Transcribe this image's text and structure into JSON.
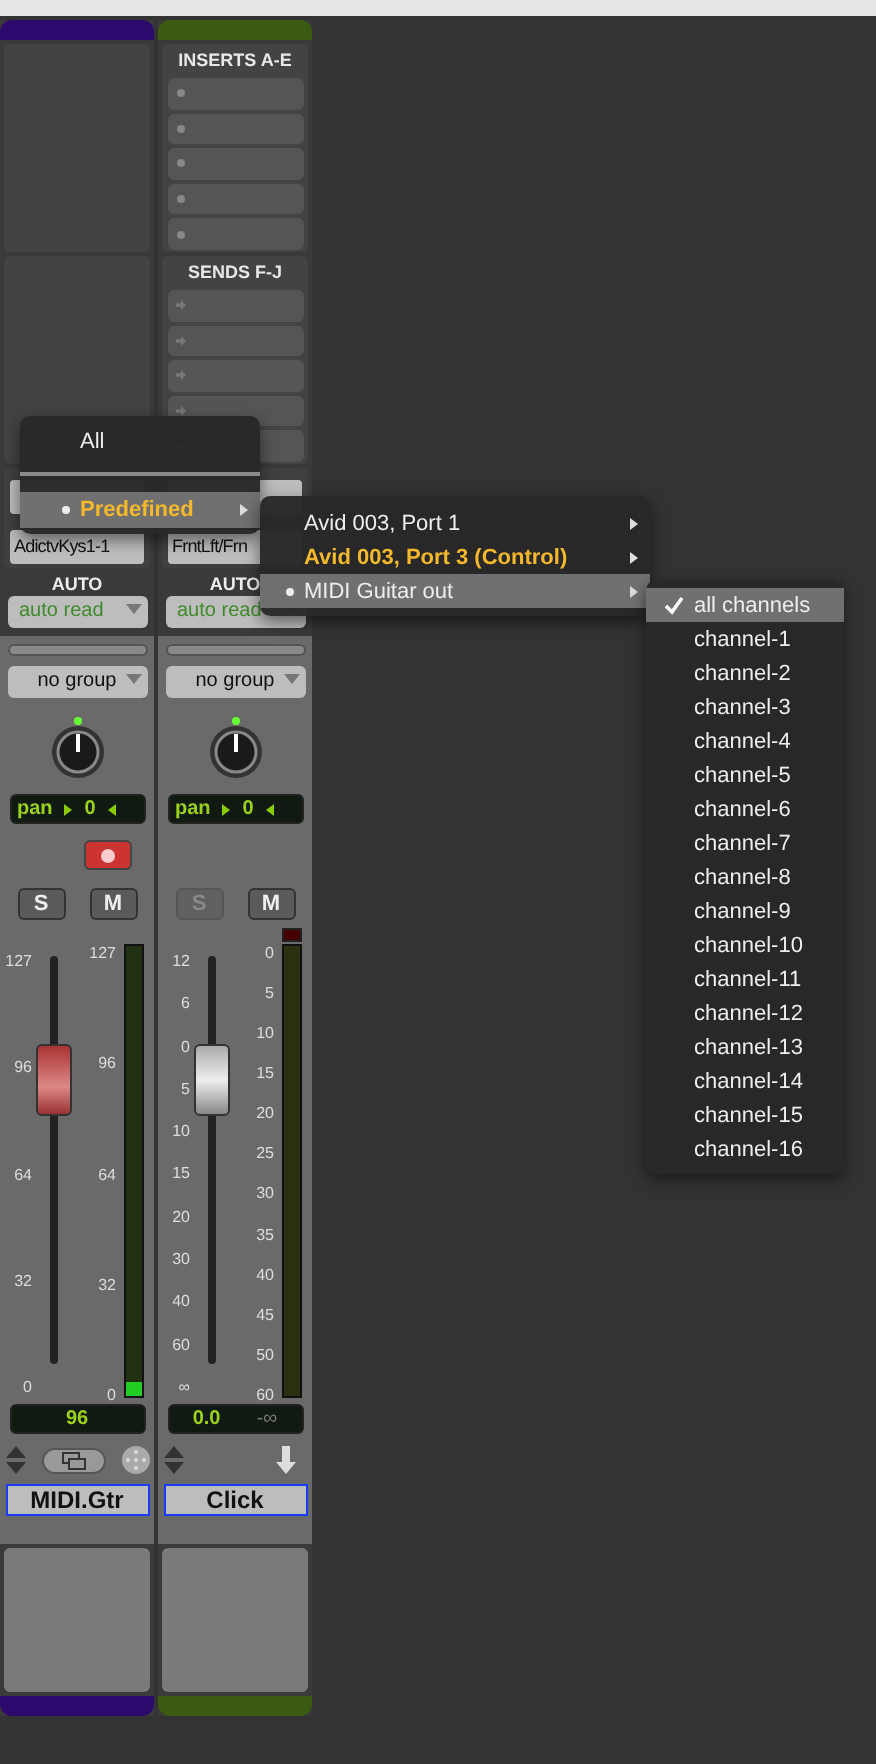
{
  "strips": [
    {
      "kind": "midi",
      "color": "#2d0a6e",
      "output": "AdictvKys1-1",
      "auto_label": "AUTO",
      "auto_mode": "auto read",
      "group": "no group",
      "pan_label": "pan",
      "pan_value": "0",
      "record_armed": true,
      "solo": "S",
      "solo_disabled": false,
      "mute": "M",
      "fader_ticks": [
        "127",
        "96",
        "64",
        "32",
        "0"
      ],
      "meter_ticks": [
        "127",
        "96",
        "64",
        "32",
        "0"
      ],
      "level": 0.74,
      "meter": {
        "level": 0.03
      },
      "volume": "96",
      "name": "MIDI.Gtr",
      "name_selected": true
    },
    {
      "kind": "aux",
      "color": "#3c5a12",
      "sections": [
        {
          "kind": "inserts",
          "title": "INSERTS A-E"
        },
        {
          "kind": "sends",
          "title": "SENDS F-J"
        }
      ],
      "output": "FrntLft/Frn",
      "auto_label": "AUTO",
      "auto_mode": "auto read",
      "group": "no group",
      "pan_label": "pan",
      "pan_value": "0",
      "solo": "S",
      "solo_disabled": true,
      "mute": "M",
      "fader_ticks": [
        "12",
        "6",
        "0",
        "5",
        "10",
        "15",
        "20",
        "30",
        "40",
        "60",
        "∞"
      ],
      "meter_ticks": [
        "0",
        "5",
        "10",
        "15",
        "20",
        "25",
        "30",
        "35",
        "40",
        "45",
        "50",
        "60"
      ],
      "level": 0.74,
      "volume": "0.0",
      "volume_peak": "-∞",
      "name": "Click",
      "name_selected": true
    }
  ],
  "menu": [
    {
      "kind": "item",
      "label": "All",
      "selected": false,
      "active": false,
      "bullet": false,
      "submenu": false
    },
    {
      "kind": "separator"
    },
    {
      "kind": "item",
      "label": "Predefined",
      "selected": true,
      "active": true,
      "bullet": true,
      "submenu": true
    }
  ],
  "submenu": [
    {
      "label": "Avid 003, Port 1",
      "selected": false,
      "active": false,
      "bullet": false,
      "submenu": true
    },
    {
      "label": "Avid 003, Port 3 (Control)",
      "selected": false,
      "active": true,
      "bullet": false,
      "submenu": true
    },
    {
      "label": "MIDI Guitar out",
      "selected": true,
      "active": false,
      "bullet": true,
      "submenu": true
    }
  ],
  "channels": [
    {
      "label": "all channels",
      "checked": true,
      "selected": true
    },
    {
      "label": "channel-1",
      "checked": false,
      "selected": false
    },
    {
      "label": "channel-2",
      "checked": false,
      "selected": false
    },
    {
      "label": "channel-3",
      "checked": false,
      "selected": false
    },
    {
      "label": "channel-4",
      "checked": false,
      "selected": false
    },
    {
      "label": "channel-5",
      "checked": false,
      "selected": false
    },
    {
      "label": "channel-6",
      "checked": false,
      "selected": false
    },
    {
      "label": "channel-7",
      "checked": false,
      "selected": false
    },
    {
      "label": "channel-8",
      "checked": false,
      "selected": false
    },
    {
      "label": "channel-9",
      "checked": false,
      "selected": false
    },
    {
      "label": "channel-10",
      "checked": false,
      "selected": false
    },
    {
      "label": "channel-11",
      "checked": false,
      "selected": false
    },
    {
      "label": "channel-12",
      "checked": false,
      "selected": false
    },
    {
      "label": "channel-13",
      "checked": false,
      "selected": false
    },
    {
      "label": "channel-14",
      "checked": false,
      "selected": false
    },
    {
      "label": "channel-15",
      "checked": false,
      "selected": false
    },
    {
      "label": "channel-16",
      "checked": false,
      "selected": false
    }
  ]
}
